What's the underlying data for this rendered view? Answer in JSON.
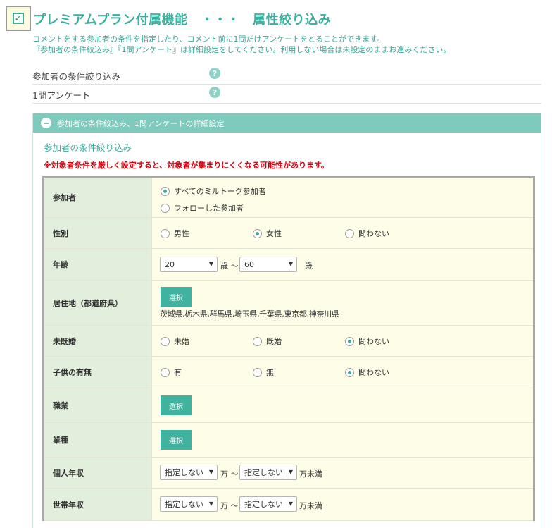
{
  "header": {
    "title": "プレミアムプラン付属機能　・・・　属性絞り込み",
    "desc_line1": "コメントをする参加者の条件を指定したり、コメント前に1問だけアンケートをとることができます。",
    "desc_line2": "『参加者の条件絞込み』『1問アンケート』は詳細設定をしてください。利用しない場合は未設定のままお進みください。"
  },
  "options": [
    {
      "label": "参加者の条件絞り込み",
      "help": "?"
    },
    {
      "label": "1問アンケート",
      "help": "?"
    }
  ],
  "panel": {
    "head": "参加者の条件絞込み、1問アンケートの詳細設定",
    "sub_title": "参加者の条件絞り込み",
    "warning": "※対象者条件を厳しく設定すると、対象者が集まりにくくなる可能性があります。"
  },
  "form": {
    "participant": {
      "label": "参加者",
      "opt1": "すべてのミルトーク参加者",
      "opt2": "フォローした参加者"
    },
    "gender": {
      "label": "性別",
      "opt1": "男性",
      "opt2": "女性",
      "opt3": "問わない"
    },
    "age": {
      "label": "年齢",
      "from": "20",
      "to": "60",
      "unit1": "歳 ～",
      "unit2": "歳"
    },
    "residence": {
      "label": "居住地（都道府県）",
      "button": "選択",
      "value": "茨城県,栃木県,群馬県,埼玉県,千葉県,東京都,神奈川県"
    },
    "marital": {
      "label": "未既婚",
      "opt1": "未婚",
      "opt2": "既婚",
      "opt3": "問わない"
    },
    "children": {
      "label": "子供の有無",
      "opt1": "有",
      "opt2": "無",
      "opt3": "問わない"
    },
    "occupation": {
      "label": "職業",
      "button": "選択"
    },
    "industry": {
      "label": "業種",
      "button": "選択"
    },
    "personal_income": {
      "label": "個人年収",
      "from": "指定しない",
      "to": "指定しない",
      "unit1": "万 ～",
      "unit2": "万未満"
    },
    "household_income": {
      "label": "世帯年収",
      "from": "指定しない",
      "to": "指定しない",
      "unit1": "万 ～",
      "unit2": "万未満"
    }
  }
}
